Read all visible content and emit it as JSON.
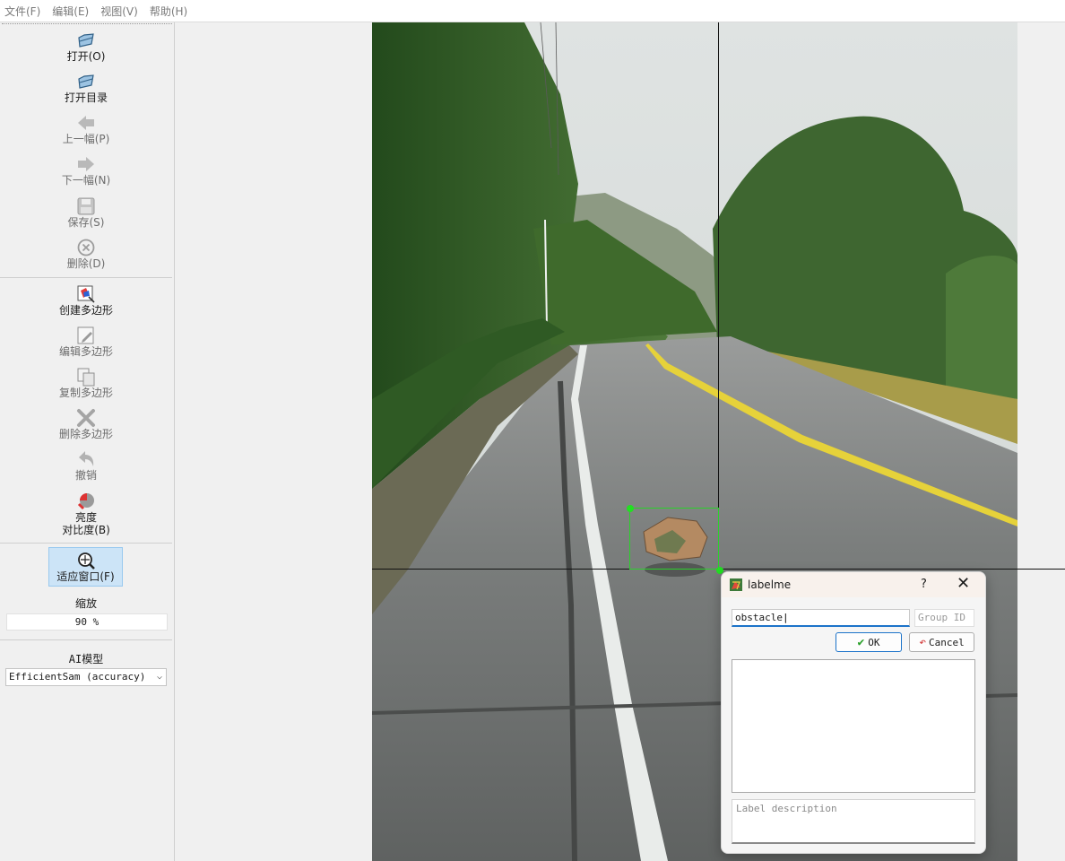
{
  "menu": [
    "文件(F)",
    "编辑(E)",
    "视图(V)",
    "帮助(H)"
  ],
  "toolbar": {
    "open": "打开(O)",
    "open_dir": "打开目录",
    "prev": "上一幅(P)",
    "next": "下一幅(N)",
    "save": "保存(S)",
    "delete": "删除(D)",
    "create_polygon": "创建多边形",
    "edit_polygon": "编辑多边形",
    "copy_polygon": "复制多边形",
    "delete_polygon": "删除多边形",
    "undo": "撤销",
    "brightness_1": "亮度",
    "brightness_2": "对比度(B)",
    "fit_window": "适应窗口(F)",
    "zoom_label": "缩放",
    "zoom_value": "90 %",
    "ai_label": "AI模型",
    "ai_model": "EfficientSam (accuracy)"
  },
  "dialog": {
    "title": "labelme",
    "help": "?",
    "label_value": "obstacle",
    "group_id_placeholder": "Group ID",
    "ok": "OK",
    "cancel": "Cancel",
    "description_placeholder": "Label description"
  },
  "colors": {
    "bbox": "#2bd12b",
    "accent": "#1c73c9"
  }
}
